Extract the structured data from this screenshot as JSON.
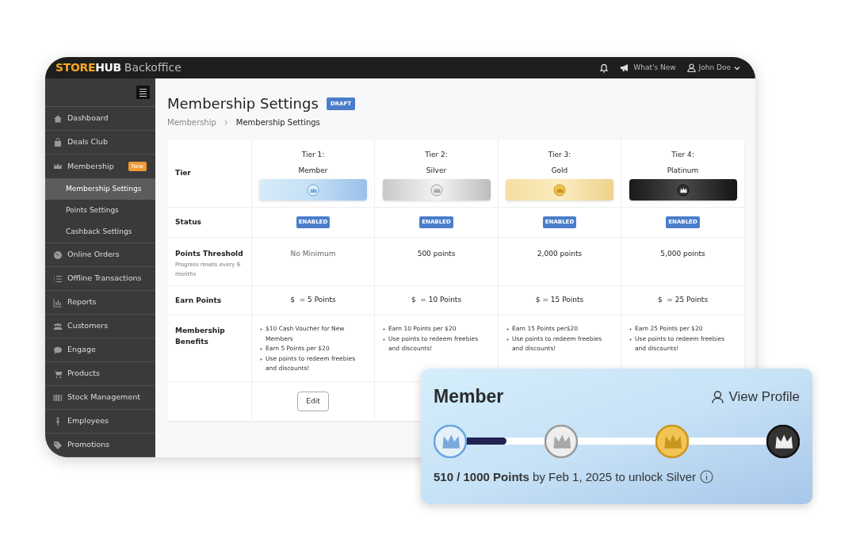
{
  "topbar": {
    "logo_left": "STORE",
    "logo_right": "HUB",
    "product": "Backoffice",
    "whats_new": "What's New",
    "user": "John Doe"
  },
  "sidebar": {
    "items": [
      {
        "label": "Dashboard",
        "selected": false
      },
      {
        "label": "Deals Club",
        "selected": false
      },
      {
        "label": "Membership",
        "selected": false,
        "badge": "New",
        "children": [
          {
            "label": "Membership Settings",
            "selected": true
          },
          {
            "label": "Points Settings",
            "selected": false
          },
          {
            "label": "Cashback Settings",
            "selected": false
          }
        ]
      },
      {
        "label": "Online Orders",
        "selected": false
      },
      {
        "label": "Offline Transactions",
        "selected": false
      },
      {
        "label": "Reports",
        "selected": false
      },
      {
        "label": "Customers",
        "selected": false
      },
      {
        "label": "Engage",
        "selected": false
      },
      {
        "label": "Products",
        "selected": false
      },
      {
        "label": "Stock Management",
        "selected": false
      },
      {
        "label": "Employees",
        "selected": false
      },
      {
        "label": "Promotions",
        "selected": false
      }
    ]
  },
  "page": {
    "title": "Membership Settings",
    "badge": "DRAFT",
    "breadcrumb": [
      "Membership",
      "Membership Settings"
    ]
  },
  "table": {
    "row_labels": {
      "tier": "Tier",
      "status": "Status",
      "threshold": "Points Threshold",
      "threshold_note": "Progress resets every 6 months",
      "earn": "Earn Points",
      "benefits": "Membership Benefits"
    },
    "tiers": [
      {
        "heading": "Tier 1:",
        "name": "Member",
        "kind": "member",
        "status": "ENABLED",
        "threshold": "No Minimum",
        "earn": "$  = 5 Points",
        "benefits": [
          "$10  Cash Voucher for New Members",
          "Earn 5 Points per $20",
          "Use points to redeem freebies and discounts!"
        ],
        "edit": "Edit"
      },
      {
        "heading": "Tier 2:",
        "name": "Silver",
        "kind": "silver",
        "status": "ENABLED",
        "threshold": "500 points",
        "earn": "$  = 10 Points",
        "benefits": [
          "Earn 10 Points per $20",
          "Use points to redeem freebies and discounts!"
        ]
      },
      {
        "heading": "Tier 3:",
        "name": "Gold",
        "kind": "gold",
        "status": "ENABLED",
        "threshold": "2,000 points",
        "earn": "$ = 15 Points",
        "benefits": [
          "Earn 15 Points per$20",
          "Use points to redeem freebies and discounts!"
        ]
      },
      {
        "heading": "Tier 4:",
        "name": "Platinum",
        "kind": "platinum",
        "status": "ENABLED",
        "threshold": "5,000 points",
        "earn": "$  = 25 Points",
        "benefits": [
          "Earn 25 Points per $20",
          "Use points to redeem freebies and discounts!"
        ]
      }
    ]
  },
  "member_card": {
    "title": "Member",
    "link": "View Profile",
    "progress": {
      "level": 0.51
    },
    "milestones": [
      {
        "kind": "member"
      },
      {
        "kind": "silver"
      },
      {
        "kind": "gold"
      },
      {
        "kind": "platinum"
      }
    ],
    "summary": "**510 / 1000 Points** by Feb 1, 2025 to unlock Silver"
  }
}
